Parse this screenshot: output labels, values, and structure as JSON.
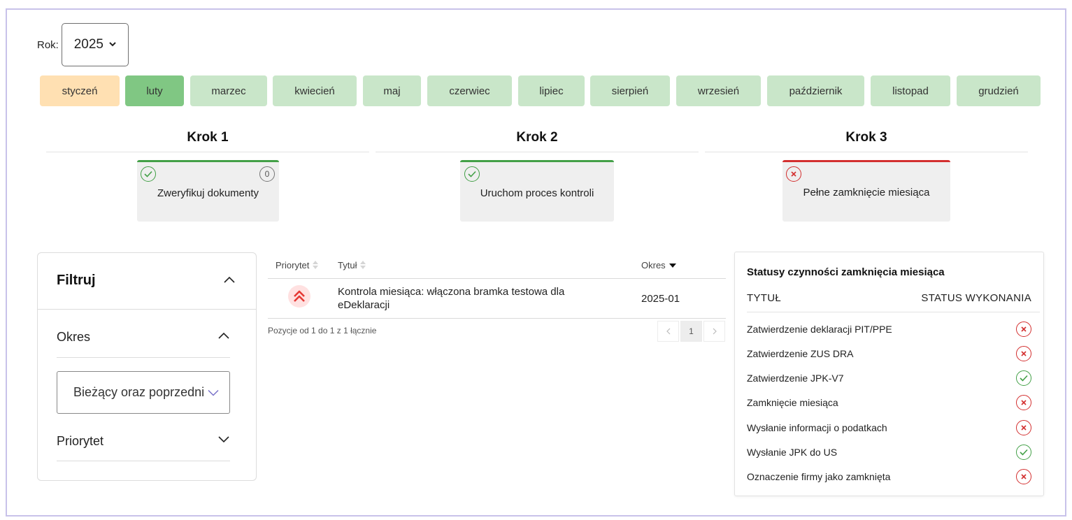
{
  "year": {
    "label": "Rok:",
    "value": "2025"
  },
  "months": [
    "styczeń",
    "luty",
    "marzec",
    "kwiecień",
    "maj",
    "czerwiec",
    "lipiec",
    "sierpień",
    "wrzesień",
    "październik",
    "listopad",
    "grudzień"
  ],
  "month_state": {
    "current": "styczeń",
    "selected": "luty"
  },
  "steps": [
    {
      "title": "Krok 1",
      "card": "Zweryfikuj dokumenty",
      "status": "ok",
      "count": "0"
    },
    {
      "title": "Krok 2",
      "card": "Uruchom proces kontroli",
      "status": "ok"
    },
    {
      "title": "Krok 3",
      "card": "Pełne zamknięcie miesiąca",
      "status": "error"
    }
  ],
  "filter": {
    "title": "Filtruj",
    "period_label": "Okres",
    "period_value": "Bieżący oraz poprzedni",
    "priority_label": "Priorytet"
  },
  "table": {
    "headers": {
      "priority": "Priorytet",
      "title": "Tytuł",
      "period": "Okres"
    },
    "rows": [
      {
        "priority": "high",
        "title": "Kontrola miesiąca: włączona bramka testowa dla eDeklaracji",
        "period": "2025-01"
      }
    ],
    "pagination_info": "Pozycje od 1 do 1 z 1 łącznie",
    "current_page": "1"
  },
  "statuses": {
    "title": "Statusy czynności zamknięcia miesiąca",
    "col_title": "TYTUŁ",
    "col_status": "STATUS WYKONANIA",
    "items": [
      {
        "label": "Zatwierdzenie deklaracji PIT/PPE",
        "done": false
      },
      {
        "label": "Zatwierdzenie ZUS DRA",
        "done": false
      },
      {
        "label": "Zatwierdzenie JPK-V7",
        "done": true
      },
      {
        "label": "Zamknięcie miesiąca",
        "done": false
      },
      {
        "label": "Wysłanie informacji o podatkach",
        "done": false
      },
      {
        "label": "Wysłanie JPK do US",
        "done": true
      },
      {
        "label": "Oznaczenie firmy jako zamknięta",
        "done": false
      }
    ]
  },
  "colors": {
    "ok": "#43a047",
    "error": "#d32f2f",
    "month": "#c9e6c9",
    "month_active": "#80c783",
    "month_current": "#ffe0b2",
    "frame": "#c8c2ea"
  }
}
